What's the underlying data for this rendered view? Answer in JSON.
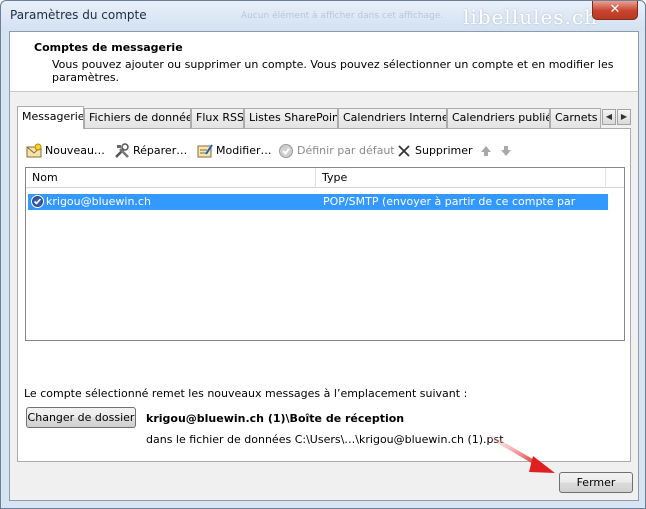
{
  "window": {
    "title": "Paramètres du compte",
    "faded_title_text": "Aucun élément à afficher dans cet affichage.",
    "watermark": "libellules.ch",
    "close_label": "✕"
  },
  "header": {
    "title": "Comptes de messagerie",
    "description": "Vous pouvez ajouter ou supprimer un compte. Vous pouvez sélectionner un compte et en modifier les paramètres."
  },
  "tabs": [
    {
      "label": "Messagerie",
      "active": true
    },
    {
      "label": "Fichiers de données"
    },
    {
      "label": "Flux RSS"
    },
    {
      "label": "Listes SharePoint"
    },
    {
      "label": "Calendriers Internet"
    },
    {
      "label": "Calendriers publiés"
    },
    {
      "label": "Carnets d'adresses"
    }
  ],
  "toolbar": {
    "new_label": "Nouveau…",
    "repair_label": "Réparer…",
    "change_label": "Modifier…",
    "default_label": "Définir par défaut",
    "delete_label": "Supprimer"
  },
  "list": {
    "columns": [
      "Nom",
      "Type"
    ],
    "rows": [
      {
        "name": "krigou@bluewin.ch",
        "type": "POP/SMTP (envoyer à partir de ce compte par défaut)",
        "selected": true
      }
    ]
  },
  "delivery": {
    "info": "Le compte sélectionné remet les nouveaux messages à l’emplacement suivant :",
    "change_folder_label": "Changer de dossier",
    "folder": "krigou@bluewin.ch (1)\\Boîte de réception",
    "data_file": "dans le fichier de données C:\\Users\\…\\krigou@bluewin.ch (1).pst"
  },
  "footer": {
    "close_label": "Fermer"
  },
  "colors": {
    "selection": "#3399ff",
    "window_frame": "#d7e4f2",
    "close_button": "#c7432d",
    "annotation_arrow": "#e02020"
  }
}
